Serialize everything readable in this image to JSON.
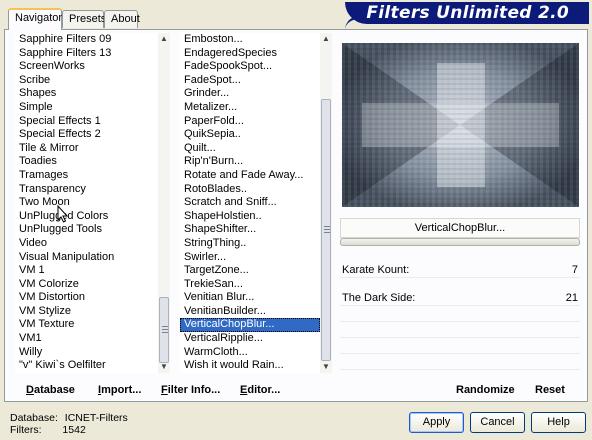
{
  "header": {
    "title": "Filters Unlimited 2.0"
  },
  "tabs": [
    {
      "label": "Navigator",
      "active": true
    },
    {
      "label": "Presets",
      "active": false
    },
    {
      "label": "About",
      "active": false
    }
  ],
  "categories": {
    "items": [
      "Sapphire Filters 09",
      "Sapphire Filters 13",
      "ScreenWorks",
      "Scribe",
      "Shapes",
      "Simple",
      "Special Effects 1",
      "Special Effects 2",
      "Tile & Mirror",
      "Toadies",
      "Tramages",
      "Transparency",
      "Two Moon",
      "UnPlugged Colors",
      "UnPlugged Tools",
      "Video",
      "Visual Manipulation",
      "VM 1",
      "VM Colorize",
      "VM Distortion",
      "VM Stylize",
      "VM Texture",
      "VM1",
      "Willy",
      "\"v\" Kiwi`s Oelfilter"
    ]
  },
  "filters": {
    "items": [
      "Emboston...",
      "EndageredSpecies",
      "FadeSpookSpot...",
      "FadeSpot...",
      "Grinder...",
      "Metalizer...",
      "PaperFold...",
      "QuikSepia..",
      "Quilt...",
      "Rip'n'Burn...",
      "Rotate and Fade Away...",
      "RotoBlades..",
      "Scratch and Sniff...",
      "ShapeHolstien..",
      "ShapeShifter...",
      "StringThing..",
      "Swirler...",
      "TargetZone...",
      "TrekieSan...",
      "Venitian Blur...",
      "VenitianBuilder...",
      "VerticalChopBlur...",
      "VerticalRipplie...",
      "WarmCloth...",
      "Wish it would Rain..."
    ],
    "selected_index": 21
  },
  "preview": {
    "selected_filter_label": "VerticalChopBlur..."
  },
  "params": [
    {
      "label": "Karate Kount:",
      "value": "7"
    },
    {
      "label": "The Dark Side:",
      "value": "21"
    }
  ],
  "actions": {
    "database": "Database",
    "import": "Import...",
    "filter_info": "Filter Info...",
    "editor": "Editor...",
    "randomize": "Randomize",
    "reset": "Reset"
  },
  "status": {
    "database_label": "Database:",
    "database_value": "ICNET-Filters",
    "filters_label": "Filters:",
    "filters_value": "1542"
  },
  "buttons": {
    "apply": "Apply",
    "cancel": "Cancel",
    "help": "Help"
  },
  "colors": {
    "banner": "#0c1a7a",
    "selection": "#316ac5"
  }
}
